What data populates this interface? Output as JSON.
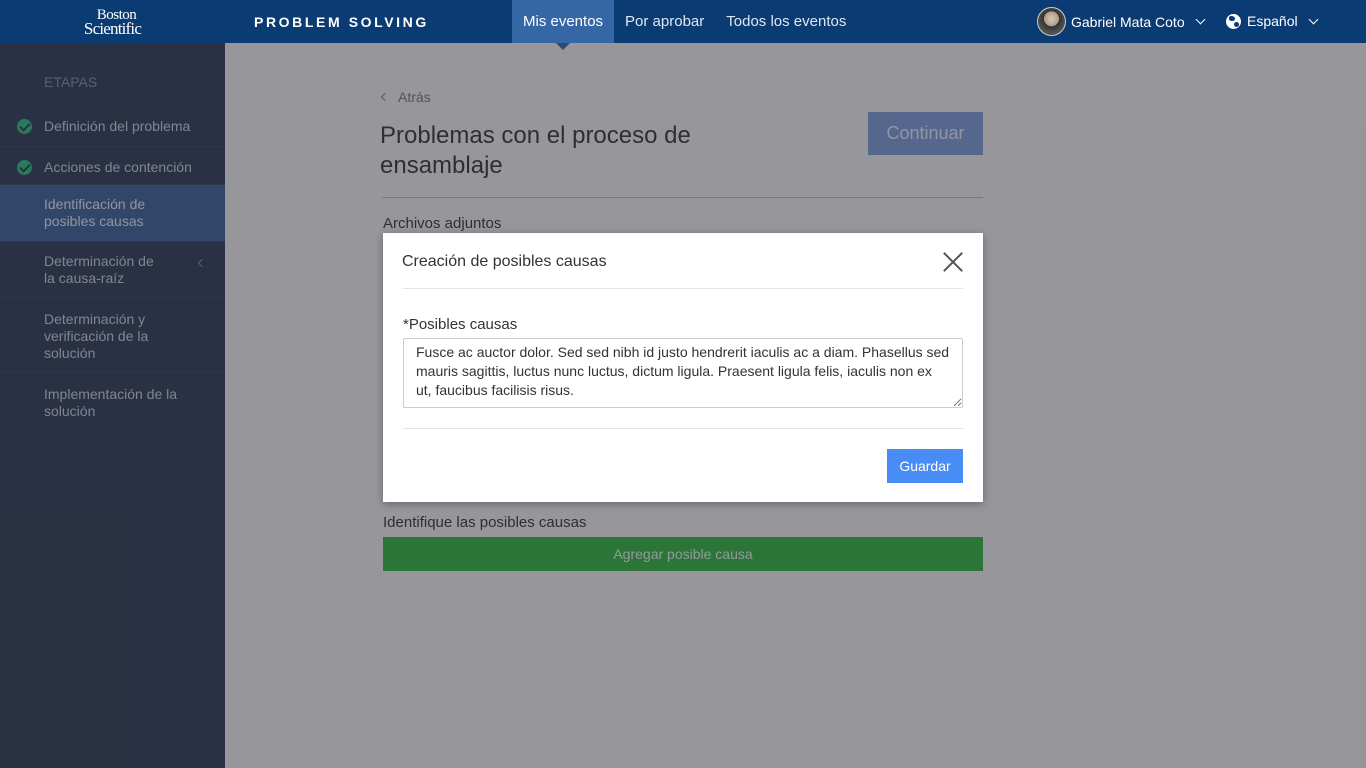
{
  "brand": {
    "logo_line1": "Boston",
    "logo_line2": "Scientific"
  },
  "header": {
    "app_title": "PROBLEM SOLVING",
    "nav": [
      "Mis eventos",
      "Por aprobar",
      "Todos los eventos"
    ],
    "active_nav": "Mis eventos",
    "user_name": "Gabriel Mata Coto",
    "language": "Español"
  },
  "sidebar": {
    "heading": "ETAPAS",
    "items": [
      {
        "label": "Definición del problema",
        "done": true
      },
      {
        "label": "Acciones de contención",
        "done": true
      },
      {
        "label": "Identificación de posibles causas",
        "active": true
      },
      {
        "label": "Determinación de la causa-raíz"
      },
      {
        "label": "Determinación y verificación de la solución"
      },
      {
        "label": "Implementación de la solución"
      }
    ]
  },
  "main": {
    "back": "Atrás",
    "title": "Problemas con el proceso de ensamblaje",
    "continue_label": "Continuar",
    "attachments_label": "Archivos adjuntos",
    "identify_label": "Identifique las posibles causas",
    "add_cause_label": "Agregar posible causa"
  },
  "modal": {
    "title": "Creación de posibles causas",
    "field_label": "*Posibles causas",
    "field_value": "Fusce ac auctor dolor. Sed sed nibh id justo hendrerit iaculis ac a diam. Phasellus sed mauris sagittis, luctus nunc luctus, dictum ligula. Praesent ligula felis, iaculis non ex ut, faucibus facilisis risus.",
    "save_label": "Guardar"
  },
  "colors": {
    "header_bg": "#0b3b73",
    "sidebar_bg": "#2c3a52",
    "active_nav": "#3566a6",
    "check": "#2cbf7d",
    "add_button": "#2fb43c",
    "save_button": "#4a8cf5",
    "continue_button": "#7b9bd8"
  }
}
